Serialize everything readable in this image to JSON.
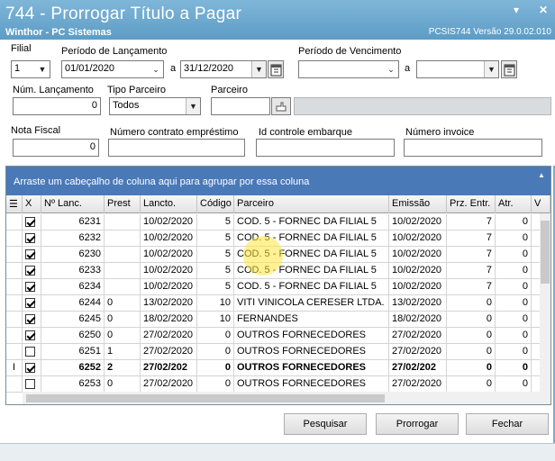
{
  "window": {
    "title": "744 - Prorrogar Título a Pagar",
    "subtitle": "Winthor - PC Sistemas",
    "version": "PCSIS744  Versão  29.0.02.010",
    "min_label": "▾",
    "close_label": "✕"
  },
  "form": {
    "filial": {
      "label": "Filial",
      "value": "1"
    },
    "periodo_lancamento": {
      "label": "Período de Lançamento",
      "from": "01/01/2020",
      "sep": "a",
      "to": "31/12/2020"
    },
    "periodo_vencimento": {
      "label": "Período de Vencimento",
      "from": "",
      "sep": "a",
      "to": ""
    },
    "num_lancamento": {
      "label": "Núm. Lançamento",
      "value": "0"
    },
    "tipo_parceiro": {
      "label": "Tipo Parceiro",
      "value": "Todos"
    },
    "parceiro": {
      "label": "Parceiro",
      "value": ""
    },
    "nota_fiscal": {
      "label": "Nota Fiscal",
      "value": "0"
    },
    "numero_contrato": {
      "label": "Número contrato empréstimo",
      "value": ""
    },
    "id_controle": {
      "label": "Id controle embarque",
      "value": ""
    },
    "numero_invoice": {
      "label": "Número invoice",
      "value": ""
    }
  },
  "grid": {
    "group_hint": "Arraste um cabeçalho de coluna aqui para agrupar por essa coluna",
    "columns": [
      "X",
      "Nº Lanc.",
      "Prest",
      "Lancto.",
      "Código",
      "Parceiro",
      "Emissão",
      "Prz. Entr.",
      "Atr.",
      "V"
    ],
    "rows": [
      {
        "checked": true,
        "num": "6231",
        "prest": "",
        "lancto": "10/02/2020",
        "codigo": "5",
        "parceiro": "COD. 5 - FORNEC DA FILIAL 5",
        "emissao": "10/02/2020",
        "prz": "7",
        "atr": "0"
      },
      {
        "checked": true,
        "num": "6232",
        "prest": "",
        "lancto": "10/02/2020",
        "codigo": "5",
        "parceiro": "COD. 5 - FORNEC DA FILIAL 5",
        "emissao": "10/02/2020",
        "prz": "7",
        "atr": "0"
      },
      {
        "checked": true,
        "num": "6230",
        "prest": "",
        "lancto": "10/02/2020",
        "codigo": "5",
        "parceiro": "COD. 5 - FORNEC DA FILIAL 5",
        "emissao": "10/02/2020",
        "prz": "7",
        "atr": "0"
      },
      {
        "checked": true,
        "num": "6233",
        "prest": "",
        "lancto": "10/02/2020",
        "codigo": "5",
        "parceiro": "COD. 5 - FORNEC DA FILIAL 5",
        "emissao": "10/02/2020",
        "prz": "7",
        "atr": "0"
      },
      {
        "checked": true,
        "num": "6234",
        "prest": "",
        "lancto": "10/02/2020",
        "codigo": "5",
        "parceiro": "COD. 5 - FORNEC DA FILIAL 5",
        "emissao": "10/02/2020",
        "prz": "7",
        "atr": "0"
      },
      {
        "checked": true,
        "num": "6244",
        "prest": "0",
        "lancto": "13/02/2020",
        "codigo": "10",
        "parceiro": "VITI VINICOLA CERESER LTDA.",
        "emissao": "13/02/2020",
        "prz": "0",
        "atr": "0"
      },
      {
        "checked": true,
        "num": "6245",
        "prest": "0",
        "lancto": "18/02/2020",
        "codigo": "10",
        "parceiro": "FERNANDES",
        "emissao": "18/02/2020",
        "prz": "0",
        "atr": "0"
      },
      {
        "checked": true,
        "num": "6250",
        "prest": "0",
        "lancto": "27/02/2020",
        "codigo": "0",
        "parceiro": "OUTROS FORNECEDORES",
        "emissao": "27/02/2020",
        "prz": "0",
        "atr": "0"
      },
      {
        "checked": false,
        "num": "6251",
        "prest": "1",
        "lancto": "27/02/2020",
        "codigo": "0",
        "parceiro": "OUTROS FORNECEDORES",
        "emissao": "27/02/2020",
        "prz": "0",
        "atr": "0"
      },
      {
        "checked": true,
        "num": "6252",
        "prest": "2",
        "lancto": "27/02/202",
        "codigo": "0",
        "parceiro": "OUTROS FORNECEDORES",
        "emissao": "27/02/202",
        "prz": "0",
        "atr": "0",
        "current": true
      },
      {
        "checked": false,
        "num": "6253",
        "prest": "0",
        "lancto": "27/02/2020",
        "codigo": "0",
        "parceiro": "OUTROS FORNECEDORES",
        "emissao": "27/02/2020",
        "prz": "0",
        "atr": "0"
      }
    ]
  },
  "buttons": {
    "pesquisar": "Pesquisar",
    "prorrogar": "Prorrogar",
    "fechar": "Fechar"
  }
}
